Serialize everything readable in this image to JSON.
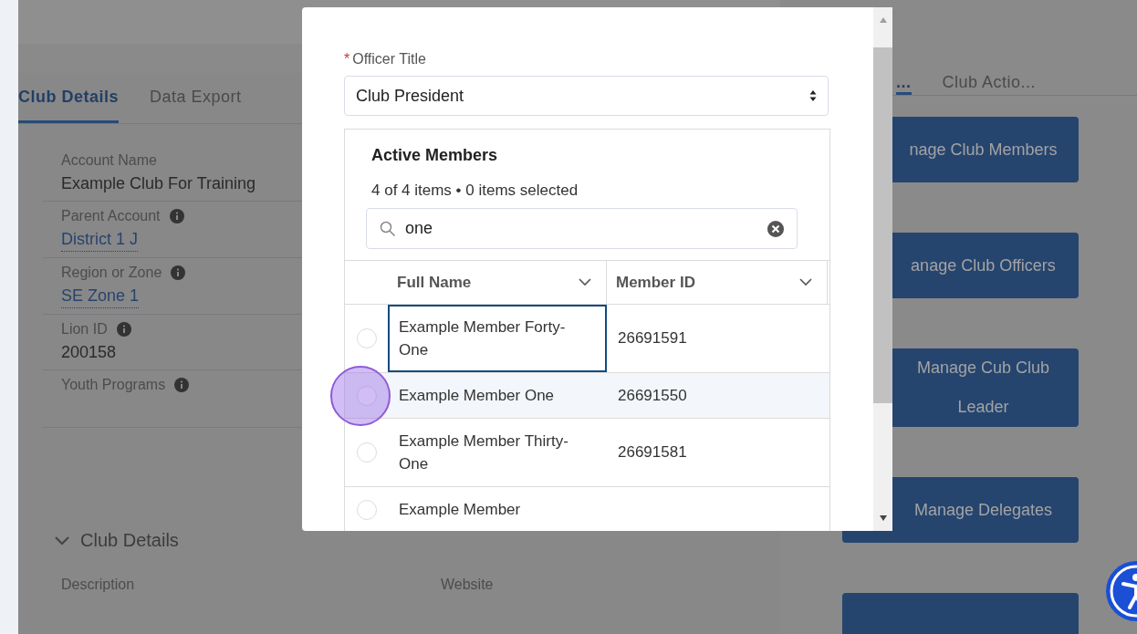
{
  "left_panel": {
    "tabs": [
      {
        "label": "Club Details",
        "selected": true
      },
      {
        "label": "Data Export",
        "selected": false
      }
    ],
    "fields": [
      {
        "label": "Account Name",
        "info": false,
        "value": "Example Club For Training",
        "link": false
      },
      {
        "label": "Parent Account",
        "info": true,
        "value": "District 1 J",
        "link": true
      },
      {
        "label": "Region or Zone",
        "info": true,
        "value": "SE Zone 1",
        "link": true
      },
      {
        "label": "Lion ID",
        "info": true,
        "value": "200158",
        "link": false
      },
      {
        "label": "Youth Programs",
        "info": true
      }
    ],
    "section": {
      "title": "Club Details",
      "expanded": true,
      "fields": [
        "Description",
        "Website"
      ]
    }
  },
  "right_panel": {
    "tabs": [
      {
        "label": "...",
        "selected": true
      },
      {
        "label": "Club Actio...",
        "selected": false
      }
    ],
    "buttons": [
      "nage Club Members",
      "anage Club Officers",
      "Manage Cub Club Leader",
      "Manage Delegates"
    ]
  },
  "modal": {
    "field": {
      "label": "Officer Title",
      "required_mark": "*",
      "value": "Club President"
    },
    "list": {
      "title": "Active Members",
      "summary": "4 of 4 items • 0 items selected",
      "search": "one",
      "columns": [
        "Full Name",
        "Member ID"
      ],
      "rows": [
        {
          "name": "Example Member Forty-One",
          "id": "26691591",
          "selected": false,
          "hovered": false,
          "focused": true
        },
        {
          "name": "Example Member One",
          "id": "26691550",
          "selected": false,
          "hovered": true,
          "focused": false
        },
        {
          "name": "Example Member Thirty-One",
          "id": "26691581",
          "selected": false,
          "hovered": false,
          "focused": false
        },
        {
          "name": "Example Member",
          "selected": false,
          "hovered": false,
          "focused": false
        }
      ]
    }
  }
}
